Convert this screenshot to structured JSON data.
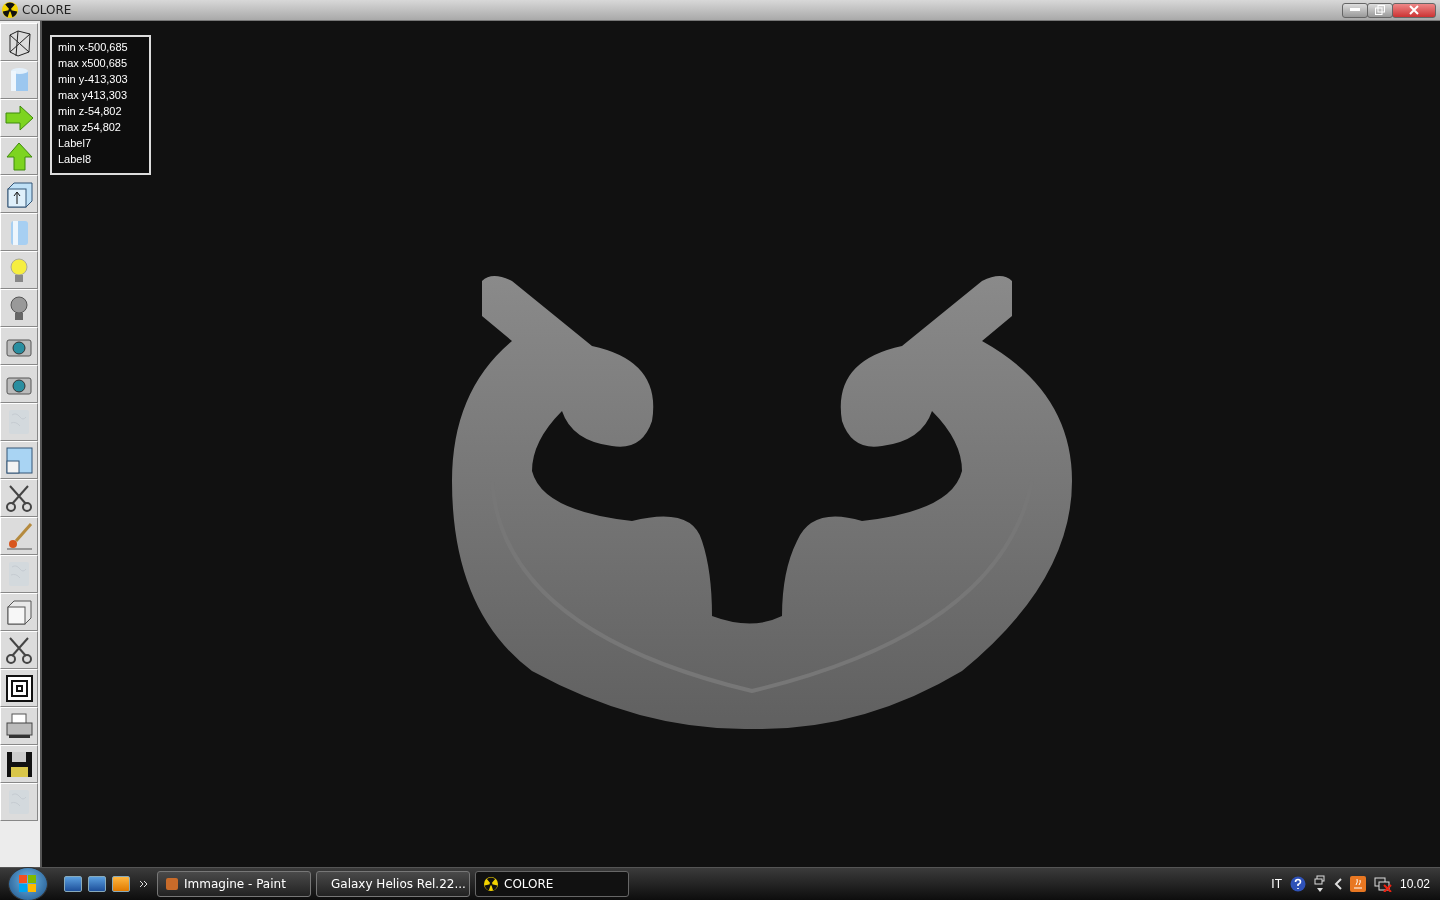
{
  "window": {
    "title": "COLORE"
  },
  "toolbar": [
    {
      "disabled": false
    },
    {
      "disabled": false
    },
    {
      "disabled": false
    },
    {
      "disabled": false
    },
    {
      "disabled": false
    },
    {
      "disabled": false
    },
    {
      "disabled": false
    },
    {
      "disabled": false
    },
    {
      "disabled": false
    },
    {
      "disabled": false
    },
    {
      "disabled": true
    },
    {
      "disabled": false
    },
    {
      "disabled": false
    },
    {
      "disabled": false
    },
    {
      "disabled": true
    },
    {
      "disabled": false
    },
    {
      "disabled": false
    },
    {
      "disabled": false
    },
    {
      "disabled": false
    },
    {
      "disabled": false
    },
    {
      "disabled": true
    }
  ],
  "info_labels": [
    "min x-500,685",
    "max x500,685",
    "min y-413,303",
    "max y413,303",
    "min z-54,802",
    "max z54,802",
    "Label7",
    "Label8"
  ],
  "taskbar": {
    "tasks": [
      {
        "label": "Immagine - Paint",
        "selected": false
      },
      {
        "label": "Galaxy Helios  Rel.22...",
        "selected": false
      },
      {
        "label": "COLORE",
        "selected": true
      }
    ],
    "language": "IT",
    "clock": "10.02"
  }
}
